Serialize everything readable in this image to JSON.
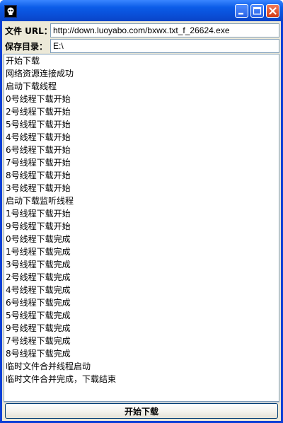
{
  "window": {
    "buttons": [
      "minimize",
      "maximize",
      "close"
    ]
  },
  "form": {
    "url_label": "文件 URL：",
    "url_value": "http://down.luoyabo.com/bxwx.txt_f_26624.exe",
    "dir_label": "保存目录：",
    "dir_value": "E:\\"
  },
  "log": {
    "lines": [
      "开始下载",
      "网络资源连接成功",
      "启动下载线程",
      "0号线程下载开始",
      "2号线程下载开始",
      "5号线程下载开始",
      "4号线程下载开始",
      "6号线程下载开始",
      "7号线程下载开始",
      "8号线程下载开始",
      "3号线程下载开始",
      "启动下载监听线程",
      "1号线程下载开始",
      "9号线程下载开始",
      "0号线程下载完成",
      "1号线程下载完成",
      "3号线程下载完成",
      "2号线程下载完成",
      "4号线程下载完成",
      "6号线程下载完成",
      "5号线程下载完成",
      "9号线程下载完成",
      "7号线程下载完成",
      "8号线程下载完成",
      "临时文件合并线程启动",
      "临时文件合并完成，下载结束"
    ]
  },
  "actions": {
    "start_label": "开始下载"
  },
  "colors": {
    "titlebar": "#0a4fd8",
    "frame_bg": "#ece9d8",
    "field_border": "#7f9db9",
    "close_button": "#d23c16"
  }
}
